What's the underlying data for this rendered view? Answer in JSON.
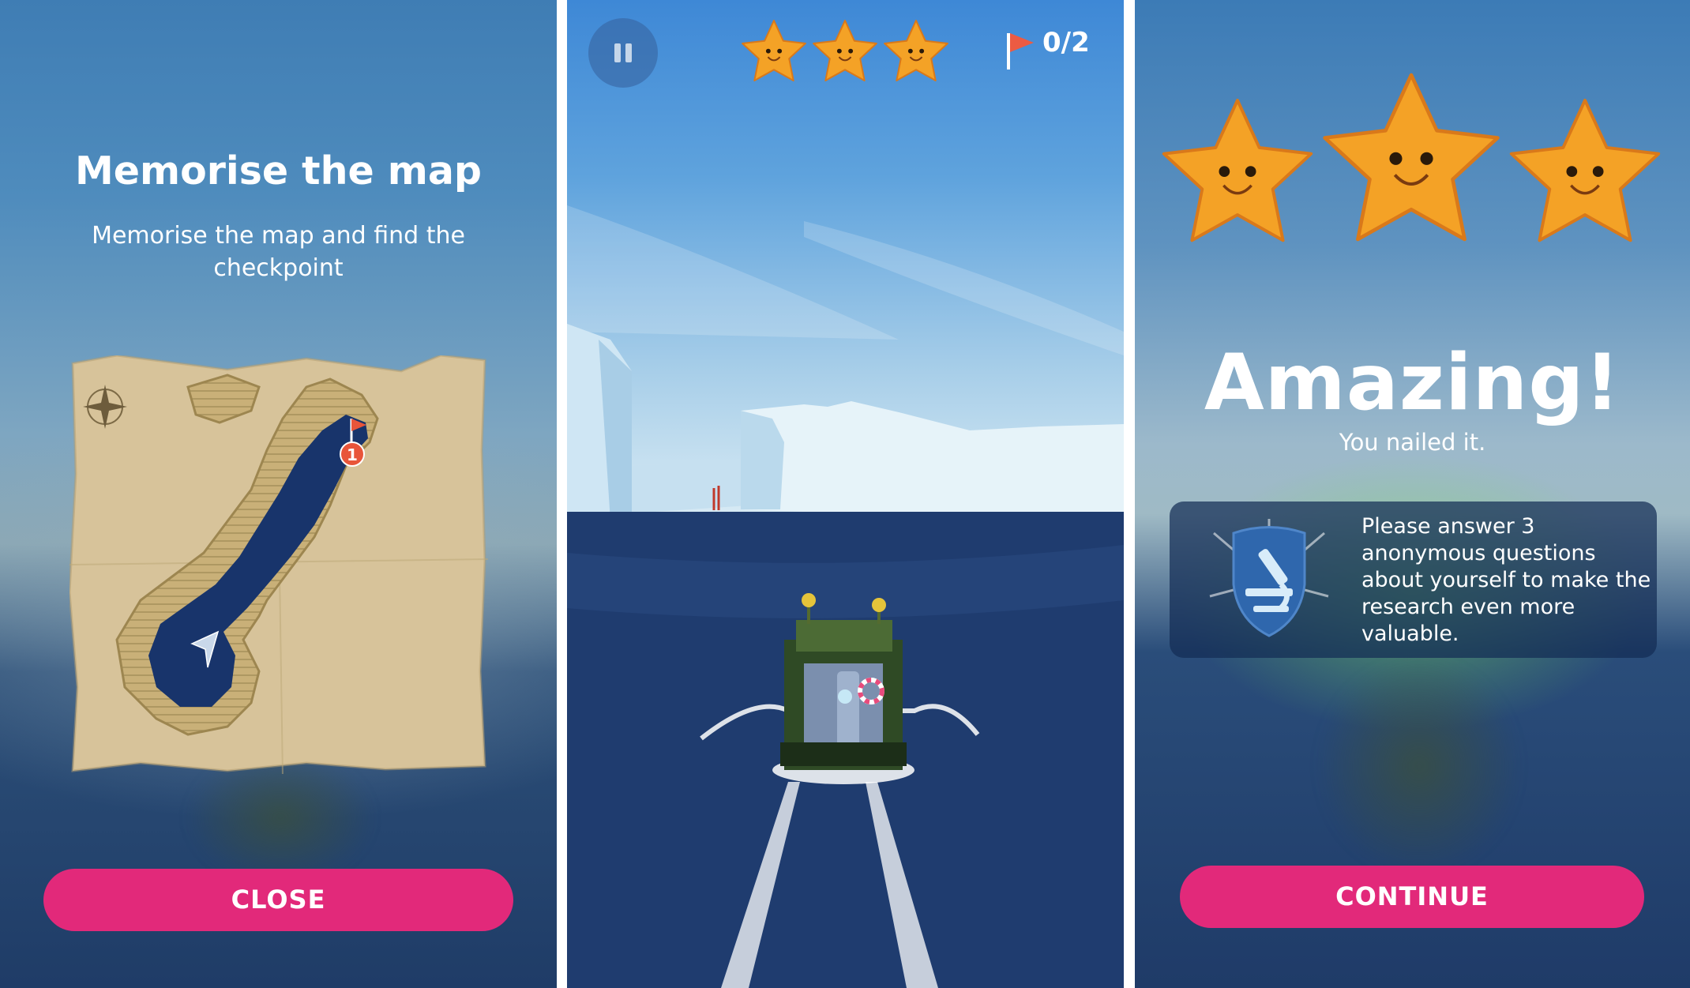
{
  "panel_memorise": {
    "title": "Memorise the map",
    "subtitle": "Memorise the map and find the checkpoint",
    "close_button": "CLOSE",
    "map": {
      "checkpoint_number": "1"
    }
  },
  "panel_game": {
    "stars_collected": 3,
    "checkpoints_label": "0/2"
  },
  "panel_result": {
    "stars": 3,
    "headline": "Amazing!",
    "tagline": "You nailed it.",
    "survey_text": "Please answer 3 anonymous questions about yourself to make the research even more valuable.",
    "continue_button": "CONTINUE"
  },
  "colors": {
    "button_pink": "#e2297a",
    "star_orange": "#f4a226",
    "flag_red": "#e8553a",
    "badge_blue": "#2f67ad"
  },
  "icons": [
    "compass-icon",
    "flag-icon",
    "player-arrow-icon",
    "pause-icon",
    "starfish-icon",
    "microscope-icon"
  ]
}
